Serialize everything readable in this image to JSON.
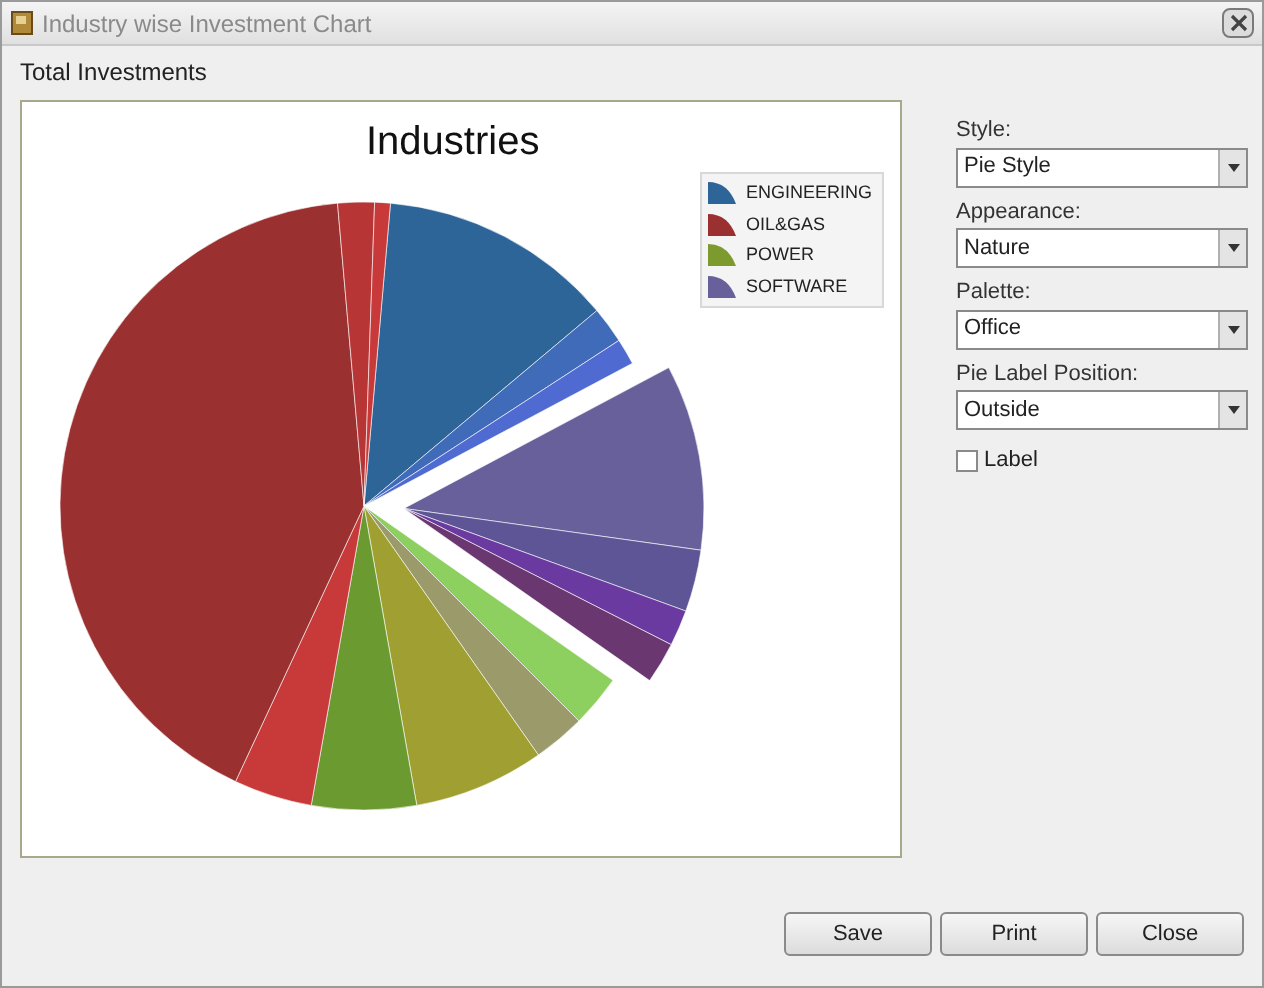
{
  "window": {
    "title": "Industry wise Investment Chart"
  },
  "group_label": "Total Investments",
  "chart": {
    "title": "Industries",
    "legend": [
      {
        "label": "ENGINEERING",
        "color": "#2e6599"
      },
      {
        "label": "OIL&GAS",
        "color": "#9b3030"
      },
      {
        "label": "POWER",
        "color": "#7c9a2e"
      },
      {
        "label": "SOFTWARE",
        "color": "#67609a"
      }
    ]
  },
  "settings": [
    {
      "kind": "dropdown",
      "label": "Style:",
      "value": "Pie Style"
    },
    {
      "kind": "dropdown",
      "label": "Appearance:",
      "value": "Nature"
    },
    {
      "kind": "dropdown",
      "label": "Palette:",
      "value": "Office"
    },
    {
      "kind": "dropdown",
      "label": "Pie Label Position:",
      "value": "Outside"
    },
    {
      "kind": "checkbox",
      "label": "Label",
      "checked": false
    }
  ],
  "buttons": [
    "Save",
    "Print",
    "Close"
  ]
}
